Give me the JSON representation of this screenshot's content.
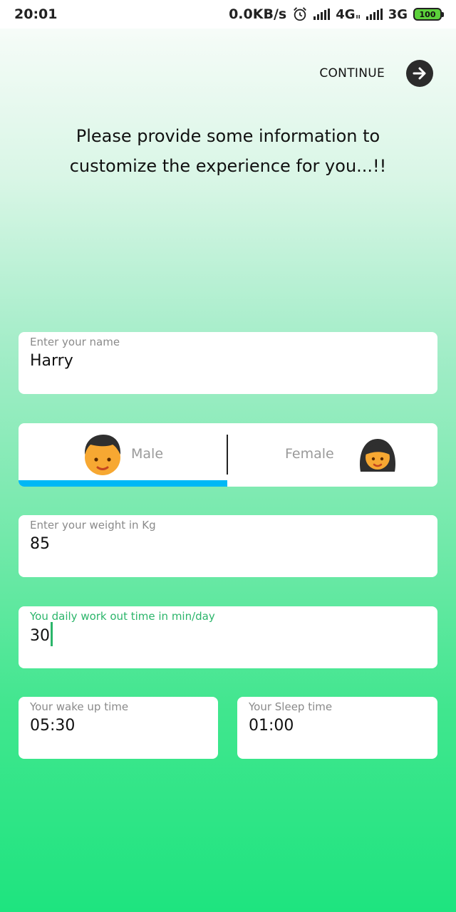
{
  "status_bar": {
    "time": "20:01",
    "speed": "0.0KB/s",
    "network_1": "4G",
    "network_1_sub": "ıı",
    "network_2": "3G",
    "battery": "100",
    "icons": [
      "alarm-clock-icon",
      "signal-icon",
      "battery-icon"
    ]
  },
  "header": {
    "continue_label": "CONTINUE",
    "continue_icon": "arrow-right-circle-icon"
  },
  "headline": "Please provide some information to customize the experience for you...!!",
  "form": {
    "name": {
      "label": "Enter your name",
      "value": "Harry"
    },
    "gender": {
      "options": [
        {
          "label": "Male",
          "icon": "male-avatar-icon"
        },
        {
          "label": "Female",
          "icon": "female-avatar-icon"
        }
      ],
      "selected": "Male",
      "indicator_color": "#00b8f5"
    },
    "weight": {
      "label": "Enter your weight in Kg",
      "value": "85"
    },
    "workout": {
      "label": "You daily work out time in min/day",
      "value": "30"
    },
    "wake_time": {
      "label": "Your wake up time",
      "value": "05:30"
    },
    "sleep_time": {
      "label": "Your Sleep time",
      "value": "01:00"
    }
  },
  "colors": {
    "accent_focus": "#2bb56a",
    "gradient_top": "#ffffff",
    "gradient_bottom": "#1ee47f"
  }
}
